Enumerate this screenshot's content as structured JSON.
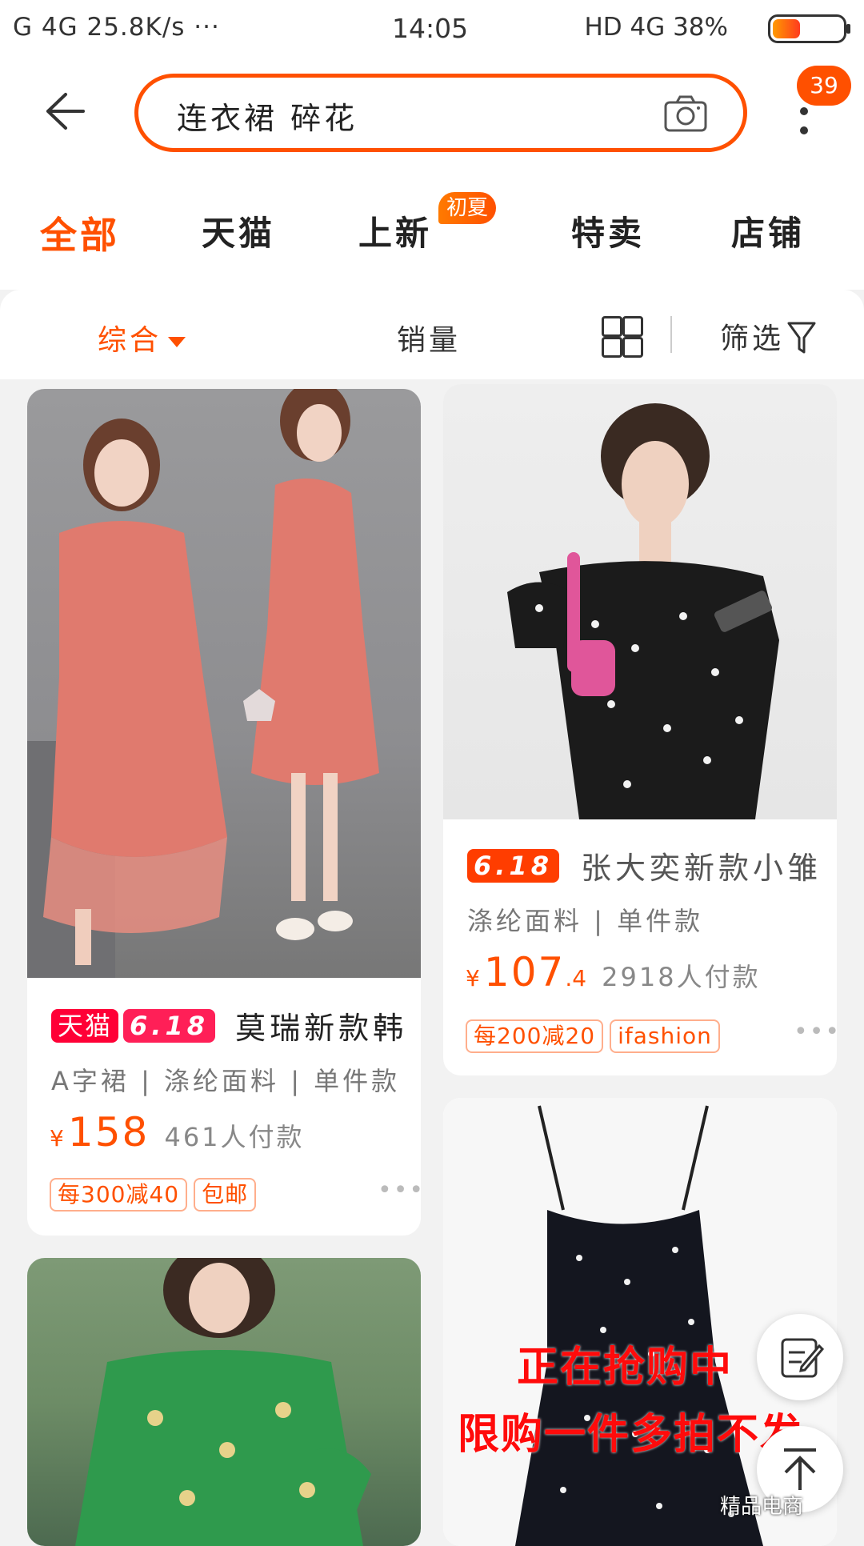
{
  "status_bar": {
    "left": "G 4G 25.8K/s ···",
    "time": "14:05",
    "right": "HD 4G 38%"
  },
  "search": {
    "back_icon": "back-arrow-icon",
    "query": "连衣裙 碎花",
    "camera_icon": "camera-icon",
    "message_badge": "39",
    "more_icon": "more-vertical-icon"
  },
  "tabs": [
    {
      "label": "全部",
      "active": true
    },
    {
      "label": "天猫"
    },
    {
      "label": "上新",
      "badge": "初夏"
    },
    {
      "label": "特卖"
    },
    {
      "label": "店铺"
    }
  ],
  "sort": {
    "comprehensive": "综合",
    "sales": "销量",
    "filter": "筛选"
  },
  "products": [
    {
      "tags": [
        "天猫",
        "6.18"
      ],
      "title": "莫瑞新款韩",
      "attrs": "A字裙 | 涤纶面料 | 单件款",
      "price_symbol": "¥",
      "price": "158",
      "sales": "461人付款",
      "chips": [
        "每300减40",
        "包邮"
      ]
    },
    {
      "tags": [
        "6.18"
      ],
      "title": "张大奕新款小雏",
      "attrs": "涤纶面料 | 单件款",
      "price_symbol": "¥",
      "price": "107",
      "price_cents": ".4",
      "sales": "2918人付款",
      "chips": [
        "每200减20",
        "ifashion"
      ]
    }
  ],
  "overlay": {
    "line1": "正在抢购中",
    "line2": "限购一件多拍不发"
  },
  "watermark": "精品电商",
  "colors": {
    "accent": "#ff5000",
    "tmall_red": "#ff0036"
  }
}
